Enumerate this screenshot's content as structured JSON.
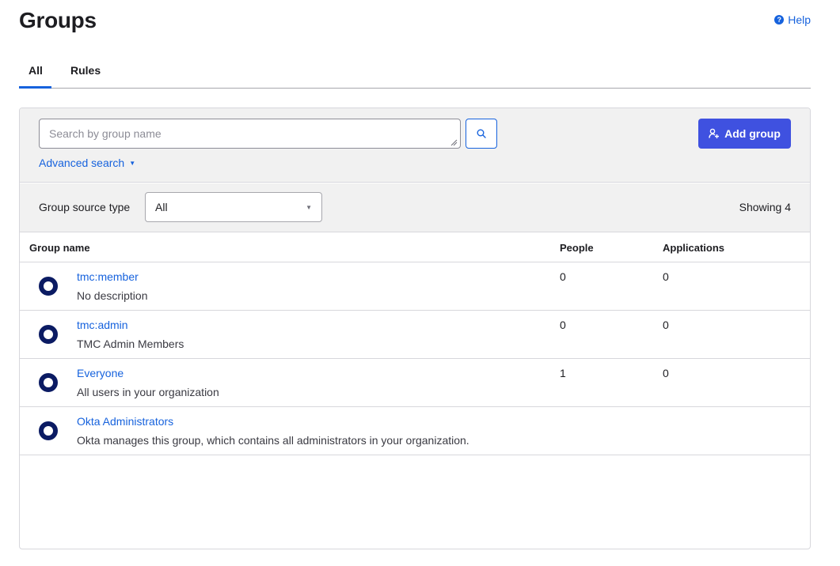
{
  "page": {
    "title": "Groups",
    "help_label": "Help",
    "help_icon": "?"
  },
  "tabs": [
    {
      "label": "All",
      "active": true
    },
    {
      "label": "Rules",
      "active": false
    }
  ],
  "search": {
    "placeholder": "Search by group name",
    "value": "",
    "advanced_label": "Advanced search",
    "advanced_caret": "▼",
    "add_group_label": "Add group"
  },
  "filter": {
    "label": "Group source type",
    "selected": "All",
    "caret": "▼",
    "showing": "Showing 4"
  },
  "table": {
    "headers": {
      "name": "Group name",
      "people": "People",
      "applications": "Applications"
    },
    "rows": [
      {
        "name": "tmc:member",
        "description": "No description",
        "people": "0",
        "applications": "0"
      },
      {
        "name": "tmc:admin",
        "description": "TMC Admin Members",
        "people": "0",
        "applications": "0"
      },
      {
        "name": "Everyone",
        "description": "All users in your organization",
        "people": "1",
        "applications": "0"
      },
      {
        "name": "Okta Administrators",
        "description": "Okta manages this group, which contains all administrators in your organization.",
        "people": "",
        "applications": ""
      }
    ]
  },
  "colors": {
    "accent": "#1662dd",
    "primary_button": "#3f51e0",
    "group_icon": "#0b1b63"
  }
}
